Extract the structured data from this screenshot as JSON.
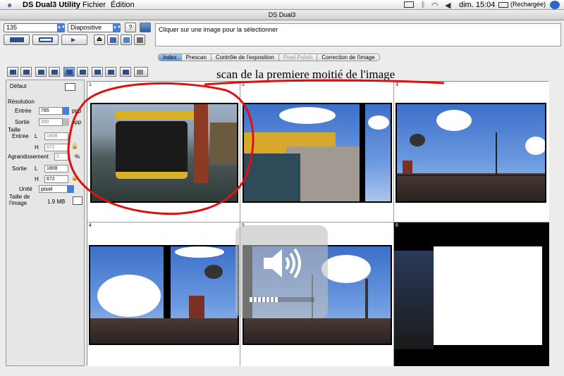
{
  "menubar": {
    "app": "DS Dual3 Utility",
    "menus": [
      "Fichier",
      "Édition"
    ],
    "clock": "dim. 15:04",
    "battery": "(Rechargée)"
  },
  "window": {
    "title": "DS Dual3"
  },
  "toolbar": {
    "film_format": "135",
    "film_type": "Diapositive"
  },
  "status": {
    "message": "Cliquer sur une image pour la sélectionner"
  },
  "tabs": [
    {
      "label": "Index",
      "active": true
    },
    {
      "label": "Prescan"
    },
    {
      "label": "Contrôle de l'exposition"
    },
    {
      "label": "Pixel Polish",
      "disabled": true
    },
    {
      "label": "Correction de l'image"
    }
  ],
  "annotation": "scan de la premiere moitié de l'image",
  "side": {
    "default_label": "Défaut",
    "resolution_label": "Résolution",
    "input_label": "Entrée",
    "input_value": "785",
    "ppp": "ppp",
    "output_label": "Sortie",
    "output_value": "380",
    "size_label": "Taille",
    "size_input_label": "Entrée",
    "w_label": "L",
    "h_label": "H",
    "size_in_w": "1808",
    "size_in_h": "672",
    "enlarge_label": "Agrandissement",
    "enlarge_value": "2",
    "percent": "%",
    "size_output_label": "Sortie",
    "size_out_w": "1808",
    "size_out_h": "672",
    "unit_label": "Unité",
    "unit_value": "pixel",
    "filesize_label": "Taille de l'image",
    "filesize_value": "1.9 MB"
  },
  "frames": [
    "1",
    "2",
    "3",
    "4",
    "5",
    "6"
  ],
  "volume": {
    "level": 0.45
  }
}
